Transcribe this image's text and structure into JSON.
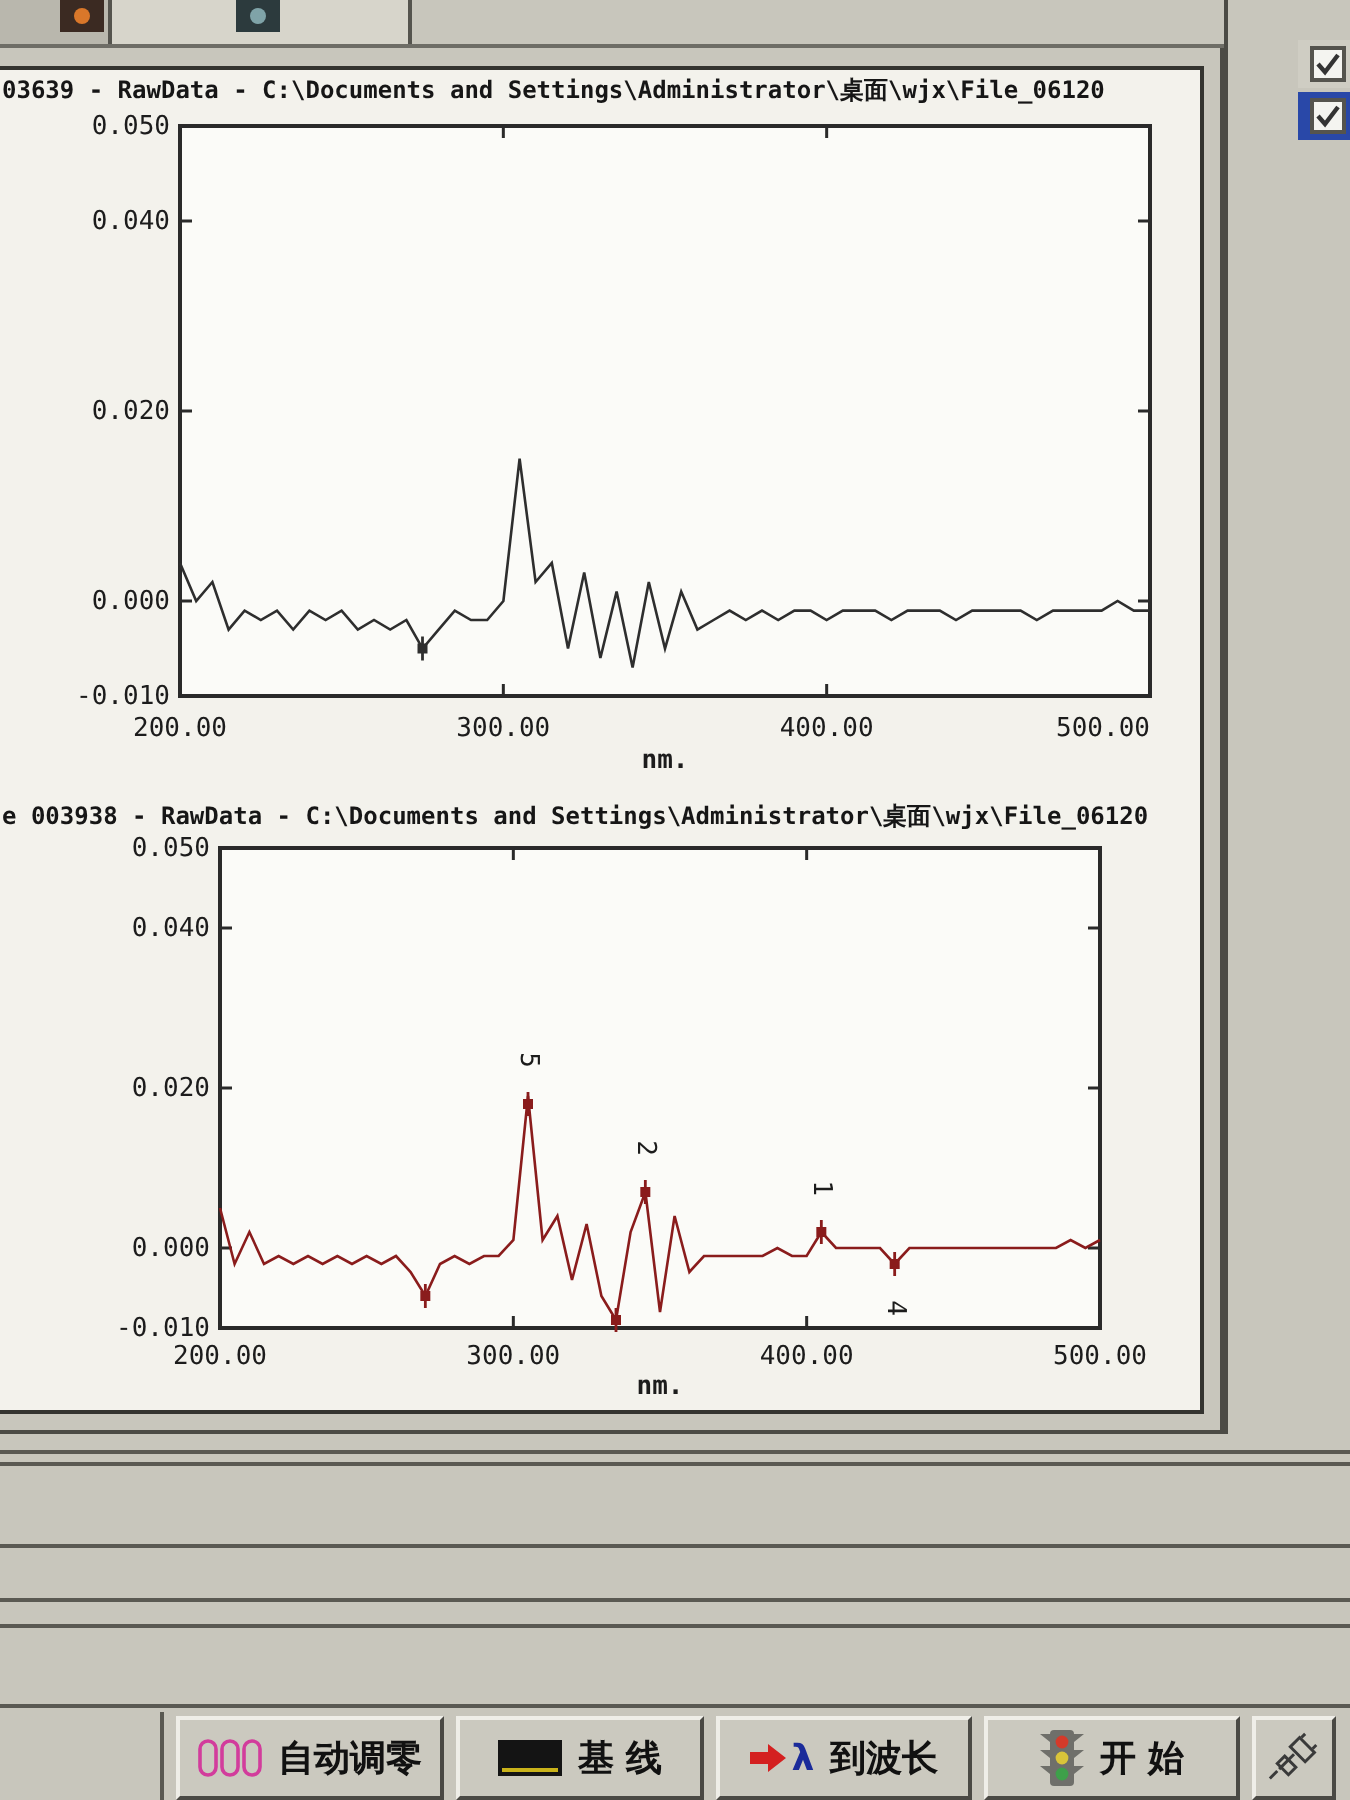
{
  "tabs": [
    {
      "selected": false
    },
    {
      "selected": true
    }
  ],
  "side_checks": [
    {
      "checked": true,
      "selected": false
    },
    {
      "checked": true,
      "selected": true
    }
  ],
  "charts": [
    {
      "title": "03639 - RawData - C:\\Documents and Settings\\Administrator\\桌面\\wjx\\File_06120",
      "chart_data": {
        "type": "line",
        "xlabel": "nm.",
        "x": [
          200,
          205,
          210,
          215,
          220,
          225,
          230,
          235,
          240,
          245,
          250,
          255,
          260,
          265,
          270,
          275,
          280,
          285,
          290,
          295,
          300,
          305,
          310,
          315,
          320,
          325,
          330,
          335,
          340,
          345,
          350,
          355,
          360,
          365,
          370,
          375,
          380,
          385,
          390,
          395,
          400,
          405,
          410,
          415,
          420,
          425,
          430,
          435,
          440,
          445,
          450,
          455,
          460,
          465,
          470,
          475,
          480,
          485,
          490,
          495,
          500
        ],
        "series": [
          {
            "color": "#2e2e2e",
            "values": [
              0.004,
              0,
              0.002,
              -0.003,
              -0.001,
              -0.002,
              -0.001,
              -0.003,
              -0.001,
              -0.002,
              -0.001,
              -0.003,
              -0.002,
              -0.003,
              -0.002,
              -0.005,
              -0.003,
              -0.001,
              -0.002,
              -0.002,
              0,
              0.015,
              0.002,
              0.004,
              -0.005,
              0.003,
              -0.006,
              0.001,
              -0.007,
              0.002,
              -0.005,
              0.001,
              -0.003,
              -0.002,
              -0.001,
              -0.002,
              -0.001,
              -0.002,
              -0.001,
              -0.001,
              -0.002,
              -0.001,
              -0.001,
              -0.001,
              -0.002,
              -0.001,
              -0.001,
              -0.001,
              -0.002,
              -0.001,
              -0.001,
              -0.001,
              -0.001,
              -0.002,
              -0.001,
              -0.001,
              -0.001,
              -0.001,
              0,
              -0.001,
              -0.001
            ]
          },
          {
            "color": "#2e2e2e",
            "marker": true,
            "values": [
              null,
              null,
              null,
              null,
              null,
              null,
              null,
              null,
              null,
              null,
              null,
              null,
              null,
              null,
              null,
              -0.005,
              null,
              null,
              null,
              null,
              null,
              null,
              null,
              null,
              null,
              null,
              null,
              null,
              null,
              null,
              null,
              null,
              null,
              null,
              null,
              null,
              null,
              null,
              null,
              null,
              null,
              null,
              null,
              null,
              null,
              null,
              null,
              null,
              null,
              null,
              null,
              null,
              null,
              null,
              null,
              null,
              null,
              null,
              null,
              null,
              null
            ]
          }
        ],
        "xlim": [
          200,
          500
        ],
        "ylim": [
          -0.01,
          0.05
        ],
        "xticks": [
          {
            "value": 200,
            "label": "200.00"
          },
          {
            "value": 300,
            "label": "300.00"
          },
          {
            "value": 400,
            "label": "400.00"
          },
          {
            "value": 500,
            "label": "500.00"
          }
        ],
        "yticks": [
          {
            "value": -0.01,
            "label": "-0.010"
          },
          {
            "value": 0,
            "label": "0.000"
          },
          {
            "value": 0.02,
            "label": "0.020"
          },
          {
            "value": 0.04,
            "label": "0.040"
          },
          {
            "value": 0.05,
            "label": "0.050"
          }
        ]
      }
    },
    {
      "title": "e 003938 - RawData - C:\\Documents and Settings\\Administrator\\桌面\\wjx\\File_06120",
      "chart_data": {
        "type": "line",
        "xlabel": "nm.",
        "x": [
          200,
          205,
          210,
          215,
          220,
          225,
          230,
          235,
          240,
          245,
          250,
          255,
          260,
          265,
          270,
          275,
          280,
          285,
          290,
          295,
          300,
          305,
          310,
          315,
          320,
          325,
          330,
          335,
          340,
          345,
          350,
          355,
          360,
          365,
          370,
          375,
          380,
          385,
          390,
          395,
          400,
          405,
          410,
          415,
          420,
          425,
          430,
          435,
          440,
          445,
          450,
          455,
          460,
          465,
          470,
          475,
          480,
          485,
          490,
          495,
          500
        ],
        "series": [
          {
            "color": "#8a1c1c",
            "values": [
              0.005,
              -0.002,
              0.002,
              -0.002,
              -0.001,
              -0.002,
              -0.001,
              -0.002,
              -0.001,
              -0.002,
              -0.001,
              -0.002,
              -0.001,
              -0.003,
              -0.006,
              -0.002,
              -0.001,
              -0.002,
              -0.001,
              -0.001,
              0.001,
              0.019,
              0.001,
              0.004,
              -0.004,
              0.003,
              -0.006,
              -0.009,
              0.002,
              0.007,
              -0.008,
              0.004,
              -0.003,
              -0.001,
              -0.001,
              -0.001,
              -0.001,
              -0.001,
              0,
              -0.001,
              -0.001,
              0.002,
              0,
              0,
              0,
              0,
              -0.002,
              0,
              0,
              0,
              0,
              0,
              0,
              0,
              0,
              0,
              0,
              0,
              0.001,
              0,
              0.001
            ]
          },
          {
            "color": "#8a1c1c",
            "marker": true,
            "values": [
              null,
              null,
              null,
              null,
              null,
              null,
              null,
              null,
              null,
              null,
              null,
              null,
              null,
              null,
              -0.006,
              null,
              null,
              null,
              null,
              null,
              null,
              0.018,
              null,
              null,
              null,
              null,
              null,
              -0.009,
              null,
              0.007,
              null,
              null,
              null,
              null,
              null,
              null,
              null,
              null,
              null,
              null,
              null,
              0.002,
              null,
              null,
              null,
              null,
              -0.002,
              null,
              null,
              null,
              null,
              null,
              null,
              null,
              null,
              null,
              null,
              null,
              null,
              null,
              null
            ]
          }
        ],
        "xlim": [
          200,
          500
        ],
        "ylim": [
          -0.01,
          0.05
        ],
        "xticks": [
          {
            "value": 200,
            "label": "200.00"
          },
          {
            "value": 300,
            "label": "300.00"
          },
          {
            "value": 400,
            "label": "400.00"
          },
          {
            "value": 500,
            "label": "500.00"
          }
        ],
        "yticks": [
          {
            "value": -0.01,
            "label": "-0.010"
          },
          {
            "value": 0,
            "label": "0.000"
          },
          {
            "value": 0.02,
            "label": "0.020"
          },
          {
            "value": 0.04,
            "label": "0.040"
          },
          {
            "value": 0.05,
            "label": "0.050"
          }
        ],
        "annotations": [
          {
            "x": 305,
            "y": 0.018,
            "text": "5"
          },
          {
            "x": 345,
            "y": 0.007,
            "text": "2"
          },
          {
            "x": 405,
            "y": 0.002,
            "text": "1"
          },
          {
            "x": 430,
            "y": -0.002,
            "text": "4"
          }
        ]
      }
    }
  ],
  "toolbar": {
    "buttons": [
      {
        "kind": "zero",
        "label": "自动调零"
      },
      {
        "kind": "baseline",
        "label": "基 线"
      },
      {
        "kind": "wavelength",
        "symbol": "λ",
        "label": "到波长"
      },
      {
        "kind": "start",
        "label": "开 始"
      },
      {
        "kind": "plug"
      }
    ]
  }
}
